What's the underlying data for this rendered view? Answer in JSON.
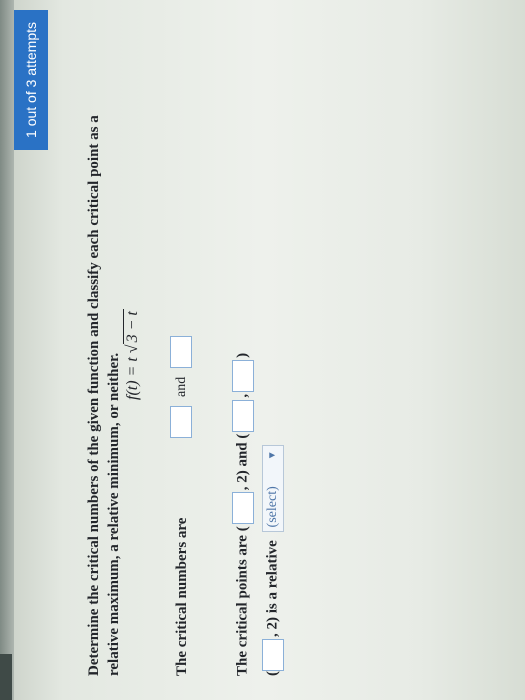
{
  "header": {
    "attempts": "1 out of 3 attempts"
  },
  "question": {
    "prompt": "Determine the critical numbers of the given function and classify each critical point as a relative maximum, a relative minimum, or neither.",
    "function_lhs": "f(t) = t",
    "function_radical": "3 − t"
  },
  "answers": {
    "critical_numbers_label": "The critical numbers are",
    "and_label": "and",
    "critical_points_label": "The critical points are",
    "paren_open": "(",
    "paren_close": ")",
    "comma": ",",
    "two_and": ", 2) and",
    "is_relative_label": ", 2) is a relative",
    "select_value": "(select)",
    "select_caret": "▼"
  }
}
